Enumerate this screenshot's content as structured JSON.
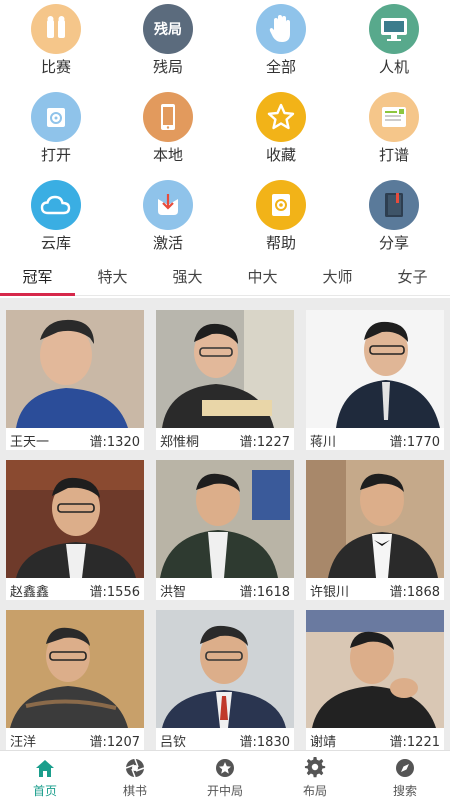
{
  "grid": {
    "items": [
      {
        "label": "比赛",
        "icon": "trophy-icon",
        "color": "#f5c68a"
      },
      {
        "label": "残局",
        "icon": "endgame-icon",
        "color": "#5b6b7d",
        "badge": "残局"
      },
      {
        "label": "全部",
        "icon": "hand-icon",
        "color": "#8fc3ea"
      },
      {
        "label": "人机",
        "icon": "computer-icon",
        "color": "#58a98c"
      },
      {
        "label": "打开",
        "icon": "folder-open-icon",
        "color": "#8fc3ea"
      },
      {
        "label": "本地",
        "icon": "phone-icon",
        "color": "#e29a5d"
      },
      {
        "label": "收藏",
        "icon": "star-icon",
        "color": "#f2b318"
      },
      {
        "label": "打谱",
        "icon": "notebook-icon",
        "color": "#f5c68a"
      },
      {
        "label": "云库",
        "icon": "cloud-icon",
        "color": "#3aaee3"
      },
      {
        "label": "激活",
        "icon": "activate-icon",
        "color": "#8fc3ea"
      },
      {
        "label": "帮助",
        "icon": "help-icon",
        "color": "#f2b318"
      },
      {
        "label": "分享",
        "icon": "share-icon",
        "color": "#5a7a9a"
      }
    ]
  },
  "tabs": [
    "冠军",
    "特大",
    "强大",
    "中大",
    "大师",
    "女子"
  ],
  "active_tab": 0,
  "players": [
    {
      "name": "王天一",
      "score": "谱:1320",
      "bg": "#c9b8a6",
      "shirt": "#2b4d99"
    },
    {
      "name": "郑惟桐",
      "score": "谱:1227",
      "bg": "#b8b6ad",
      "shirt": "#2a2a2a"
    },
    {
      "name": "蒋川",
      "score": "谱:1770",
      "bg": "#f5f5f5",
      "shirt": "#1f2a3c"
    },
    {
      "name": "赵鑫鑫",
      "score": "谱:1556",
      "bg": "#6e3a2a",
      "shirt": "#2a2a2a"
    },
    {
      "name": "洪智",
      "score": "谱:1618",
      "bg": "#b9b4a6",
      "shirt": "#2e3a30"
    },
    {
      "name": "许银川",
      "score": "谱:1868",
      "bg": "#c5a98a",
      "shirt": "#2a2a2a"
    },
    {
      "name": "汪洋",
      "score": "谱:1207",
      "bg": "#c8a06a",
      "shirt": "#3b3b3b"
    },
    {
      "name": "吕钦",
      "score": "谱:1830",
      "bg": "#cfd3d6",
      "shirt": "#2a3550"
    },
    {
      "name": "谢靖",
      "score": "谱:1221",
      "bg": "#d9c7b4",
      "shirt": "#222222"
    }
  ],
  "nav": [
    {
      "label": "首页",
      "icon": "home-icon",
      "active": true
    },
    {
      "label": "棋书",
      "icon": "aperture-icon",
      "active": false
    },
    {
      "label": "开中局",
      "icon": "star-circle-icon",
      "active": false
    },
    {
      "label": "布局",
      "icon": "gear-icon",
      "active": false
    },
    {
      "label": "搜索",
      "icon": "compass-icon",
      "active": false
    }
  ],
  "colors": {
    "accent": "#1a9e8c",
    "tab_indicator": "#d6284a"
  }
}
